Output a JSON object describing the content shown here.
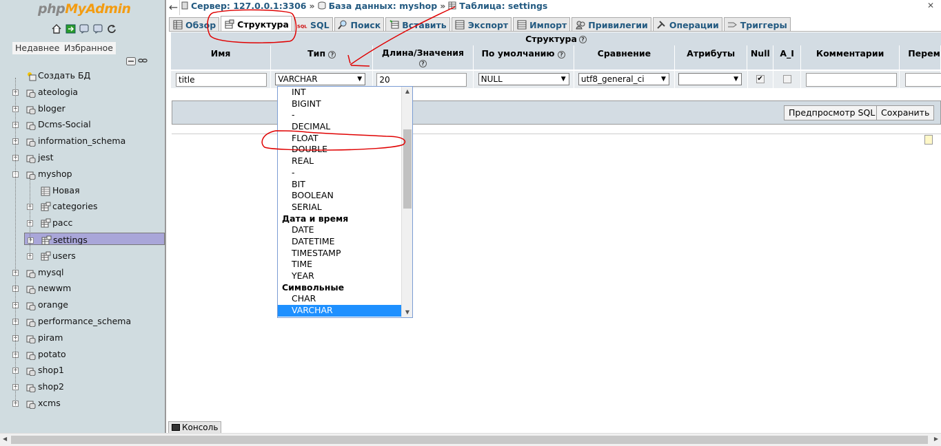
{
  "nav": {
    "logo_part1": "php",
    "logo_part2": "MyAdmin",
    "icons": [
      "home-icon",
      "exit-icon",
      "docs-icon",
      "sql-docs-icon",
      "reload-icon"
    ],
    "recent_label": "Недавнее",
    "favorites_label": "Избранное",
    "tree": [
      {
        "label": "Создать БД",
        "level": 0,
        "expander": "",
        "icon": "new-db-icon"
      },
      {
        "label": "ateologia",
        "level": 0,
        "expander": "+",
        "icon": "db-icon"
      },
      {
        "label": "bloger",
        "level": 0,
        "expander": "+",
        "icon": "db-icon"
      },
      {
        "label": "Dcms-Social",
        "level": 0,
        "expander": "+",
        "icon": "db-icon"
      },
      {
        "label": "information_schema",
        "level": 0,
        "expander": "+",
        "icon": "db-icon"
      },
      {
        "label": "jest",
        "level": 0,
        "expander": "+",
        "icon": "db-icon"
      },
      {
        "label": "myshop",
        "level": 0,
        "expander": "-",
        "icon": "db-icon"
      },
      {
        "label": "Новая",
        "level": 1,
        "expander": "",
        "icon": "new-table-icon"
      },
      {
        "label": "categories",
        "level": 1,
        "expander": "+",
        "icon": "table-icon"
      },
      {
        "label": "pacc",
        "level": 1,
        "expander": "+",
        "icon": "table-icon"
      },
      {
        "label": "settings",
        "level": 1,
        "expander": "+",
        "icon": "table-icon",
        "selected": true
      },
      {
        "label": "users",
        "level": 1,
        "expander": "+",
        "icon": "table-icon"
      },
      {
        "label": "mysql",
        "level": 0,
        "expander": "+",
        "icon": "db-icon"
      },
      {
        "label": "newwm",
        "level": 0,
        "expander": "+",
        "icon": "db-icon"
      },
      {
        "label": "orange",
        "level": 0,
        "expander": "+",
        "icon": "db-icon"
      },
      {
        "label": "performance_schema",
        "level": 0,
        "expander": "+",
        "icon": "db-icon"
      },
      {
        "label": "piram",
        "level": 0,
        "expander": "+",
        "icon": "db-icon"
      },
      {
        "label": "potato",
        "level": 0,
        "expander": "+",
        "icon": "db-icon"
      },
      {
        "label": "shop1",
        "level": 0,
        "expander": "+",
        "icon": "db-icon"
      },
      {
        "label": "shop2",
        "level": 0,
        "expander": "+",
        "icon": "db-icon"
      },
      {
        "label": "xcms",
        "level": 0,
        "expander": "+",
        "icon": "db-icon"
      }
    ]
  },
  "breadcrumb": {
    "server": "Сервер: 127.0.0.1:3306",
    "database": "База данных: myshop",
    "table": "Таблица: settings",
    "separator": "»"
  },
  "tabs": [
    {
      "label": "Обзор",
      "icon": "browse-icon"
    },
    {
      "label": "Структура",
      "icon": "structure-icon",
      "active": true
    },
    {
      "label": "SQL",
      "icon": "sql-icon"
    },
    {
      "label": "Поиск",
      "icon": "search-icon"
    },
    {
      "label": "Вставить",
      "icon": "insert-icon"
    },
    {
      "label": "Экспорт",
      "icon": "export-icon"
    },
    {
      "label": "Импорт",
      "icon": "import-icon"
    },
    {
      "label": "Привилегии",
      "icon": "privileges-icon"
    },
    {
      "label": "Операции",
      "icon": "operations-icon"
    },
    {
      "label": "Триггеры",
      "icon": "triggers-icon"
    }
  ],
  "structure": {
    "title": "Структура",
    "columns": [
      "Имя",
      "Тип",
      "Длина/Значения",
      "По умолчанию",
      "Сравнение",
      "Атрибуты",
      "Null",
      "A_I",
      "Комментарии",
      "Перем"
    ],
    "row": {
      "name": "title",
      "type": "VARCHAR",
      "length": "20",
      "default": "NULL",
      "collation": "utf8_general_ci",
      "attributes": "",
      "null_checked": true,
      "ai_checked": false,
      "comment": ""
    }
  },
  "actions": {
    "preview_sql": "Предпросмотр SQL",
    "save": "Сохранить"
  },
  "type_dropdown": {
    "options": [
      {
        "label": "INT"
      },
      {
        "label": "BIGINT"
      },
      {
        "label": "-"
      },
      {
        "label": "DECIMAL"
      },
      {
        "label": "FLOAT"
      },
      {
        "label": "DOUBLE"
      },
      {
        "label": "REAL"
      },
      {
        "label": "-"
      },
      {
        "label": "BIT"
      },
      {
        "label": "BOOLEAN"
      },
      {
        "label": "SERIAL"
      },
      {
        "label": "Дата и время",
        "group": true
      },
      {
        "label": "DATE"
      },
      {
        "label": "DATETIME"
      },
      {
        "label": "TIMESTAMP"
      },
      {
        "label": "TIME"
      },
      {
        "label": "YEAR"
      },
      {
        "label": "Символьные",
        "group": true
      },
      {
        "label": "CHAR"
      },
      {
        "label": "VARCHAR",
        "highlighted": true
      }
    ]
  },
  "console_label": "Консоль",
  "colors": {
    "nav_bg": "#d0dce0",
    "selected_row": "#a9a6d9",
    "header_bg": "#d3dce3",
    "link": "#235a81",
    "highlight": "#1e90ff",
    "annotation": "#e00000"
  }
}
